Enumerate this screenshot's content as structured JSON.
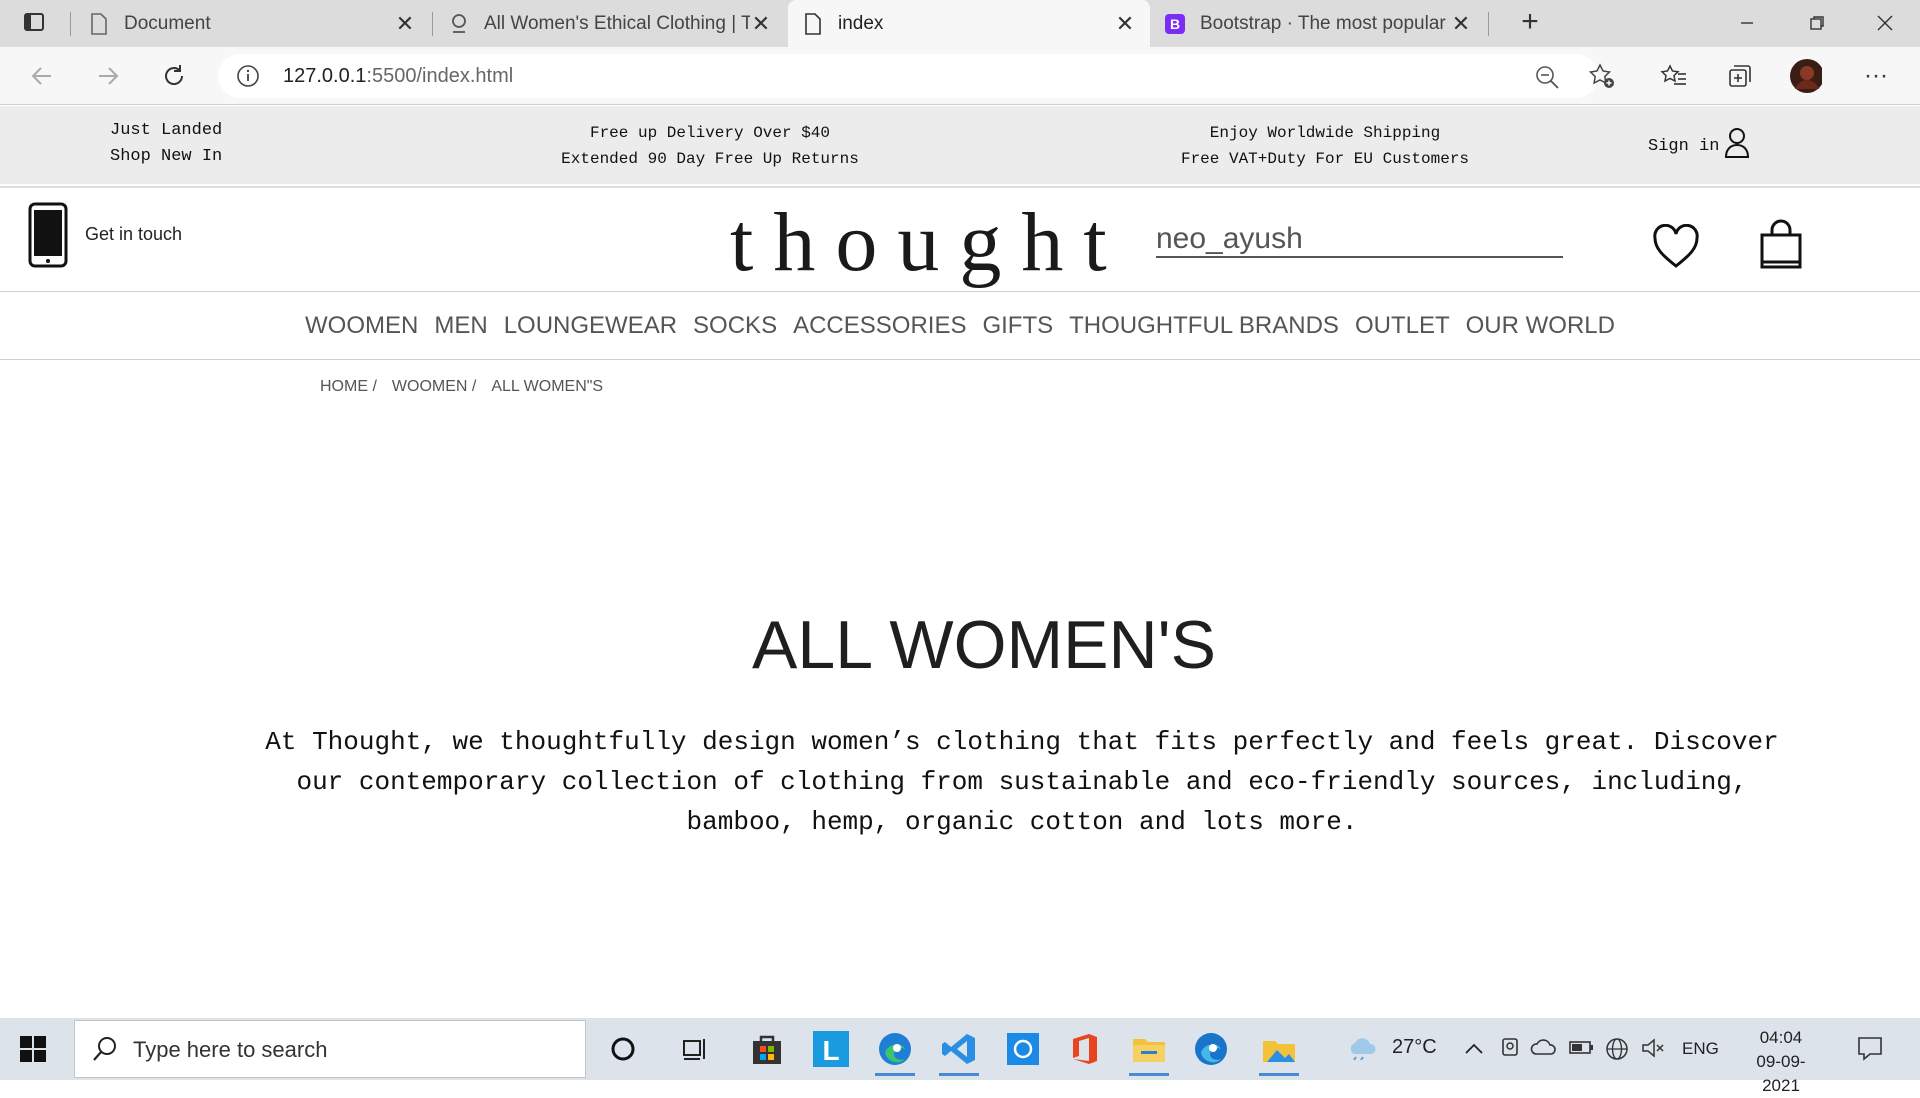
{
  "browser": {
    "tabs": [
      {
        "title": "Document",
        "icon": "page-icon",
        "active": false
      },
      {
        "title": "All Women's Ethical Clothing | Th",
        "icon": "thought-favicon-icon",
        "active": false
      },
      {
        "title": "index",
        "icon": "page-icon",
        "active": true
      },
      {
        "title": "Bootstrap · The most popular HT",
        "icon": "bootstrap-icon",
        "active": false
      }
    ],
    "url_host": "127.0.0.1",
    "url_rest": ":5500/index.html"
  },
  "topstrip": {
    "left_line1": "Just Landed",
    "left_line2": "Shop New In",
    "center_line1": "Free up Delivery Over $40",
    "center_line2": "Extended 90 Day Free Up Returns",
    "right_line1": "Enjoy Worldwide Shipping",
    "right_line2": "Free VAT+Duty For EU Customers",
    "sign_in": "Sign in"
  },
  "header": {
    "contact_label": "Get in touch",
    "logo": "thought",
    "search_value": "neo_ayush"
  },
  "menu": [
    "WOOMEN",
    "MEN",
    "LOUNGEWEAR",
    "SOCKS",
    "ACCESSORIES",
    "GIFTS",
    "THOUGHTFUL BRANDS",
    "OUTLET",
    "OUR WORLD"
  ],
  "breadcrumb": [
    "HOME /",
    "WOOMEN /",
    "ALL WOMEN\"S"
  ],
  "content": {
    "title": "ALL WOMEN'S",
    "description": "At Thought, we thoughtfully design women’s clothing that fits perfectly and feels great. Discover our contemporary collection of clothing from sustainable and eco-friendly sources, including, bamboo, hemp, organic cotton and lots more."
  },
  "taskbar": {
    "search_placeholder": "Type here to search",
    "temperature": "27°C",
    "language": "ENG",
    "time": "04:04",
    "date": "09-09-2021"
  },
  "colors": {
    "edge_blue": "#1f7fd6",
    "vscode_blue": "#2a8fe4",
    "office_red": "#e8451e",
    "bootstrap_purple": "#7b2cf5"
  }
}
